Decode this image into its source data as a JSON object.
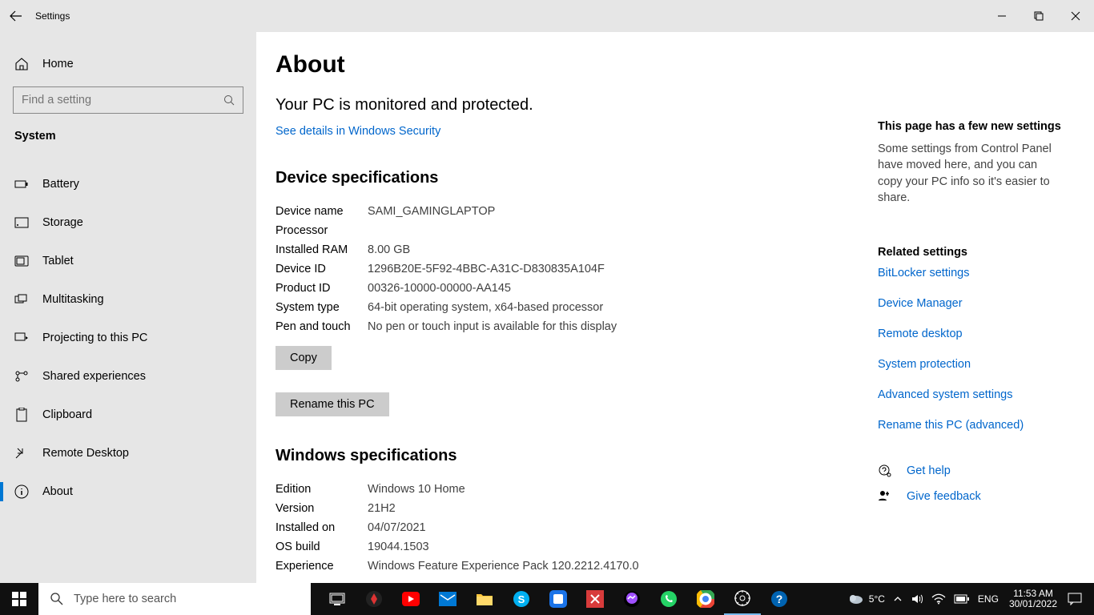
{
  "window": {
    "title": "Settings"
  },
  "sidebar": {
    "home_label": "Home",
    "search_placeholder": "Find a setting",
    "section_label": "System",
    "items": [
      {
        "label": "Battery"
      },
      {
        "label": "Storage"
      },
      {
        "label": "Tablet"
      },
      {
        "label": "Multitasking"
      },
      {
        "label": "Projecting to this PC"
      },
      {
        "label": "Shared experiences"
      },
      {
        "label": "Clipboard"
      },
      {
        "label": "Remote Desktop"
      },
      {
        "label": "About"
      }
    ]
  },
  "about": {
    "title": "About",
    "protect_text": "Your PC is monitored and protected.",
    "security_link": "See details in Windows Security",
    "device_section": "Device specifications",
    "device": {
      "name_key": "Device name",
      "name_val": "SAMI_GAMINGLAPTOP",
      "processor_key": "Processor",
      "processor_val": "",
      "ram_key": "Installed RAM",
      "ram_val": "8.00 GB",
      "deviceid_key": "Device ID",
      "deviceid_val": "1296B20E-5F92-4BBC-A31C-D830835A104F",
      "productid_key": "Product ID",
      "productid_val": "00326-10000-00000-AA145",
      "systemtype_key": "System type",
      "systemtype_val": "64-bit operating system, x64-based processor",
      "pen_key": "Pen and touch",
      "pen_val": "No pen or touch input is available for this display"
    },
    "copy_btn": "Copy",
    "rename_btn": "Rename this PC",
    "windows_section": "Windows specifications",
    "windows": {
      "edition_key": "Edition",
      "edition_val": "Windows 10 Home",
      "version_key": "Version",
      "version_val": "21H2",
      "installed_key": "Installed on",
      "installed_val": "04/07/2021",
      "build_key": "OS build",
      "build_val": "19044.1503",
      "exp_key": "Experience",
      "exp_val": "Windows Feature Experience Pack 120.2212.4170.0"
    }
  },
  "rail": {
    "new_title": "This page has a few new settings",
    "new_text": "Some settings from Control Panel have moved here, and you can copy your PC info so it's easier to share.",
    "related_title": "Related settings",
    "links": {
      "bitlocker": "BitLocker settings",
      "devicemgr": "Device Manager",
      "remote": "Remote desktop",
      "sysprotect": "System protection",
      "advanced": "Advanced system settings",
      "rename": "Rename this PC (advanced)"
    },
    "help": "Get help",
    "feedback": "Give feedback"
  },
  "taskbar": {
    "search_placeholder": "Type here to search",
    "weather_temp": "5°C",
    "lang": "ENG",
    "time": "11:53 AM",
    "date": "30/01/2022"
  }
}
